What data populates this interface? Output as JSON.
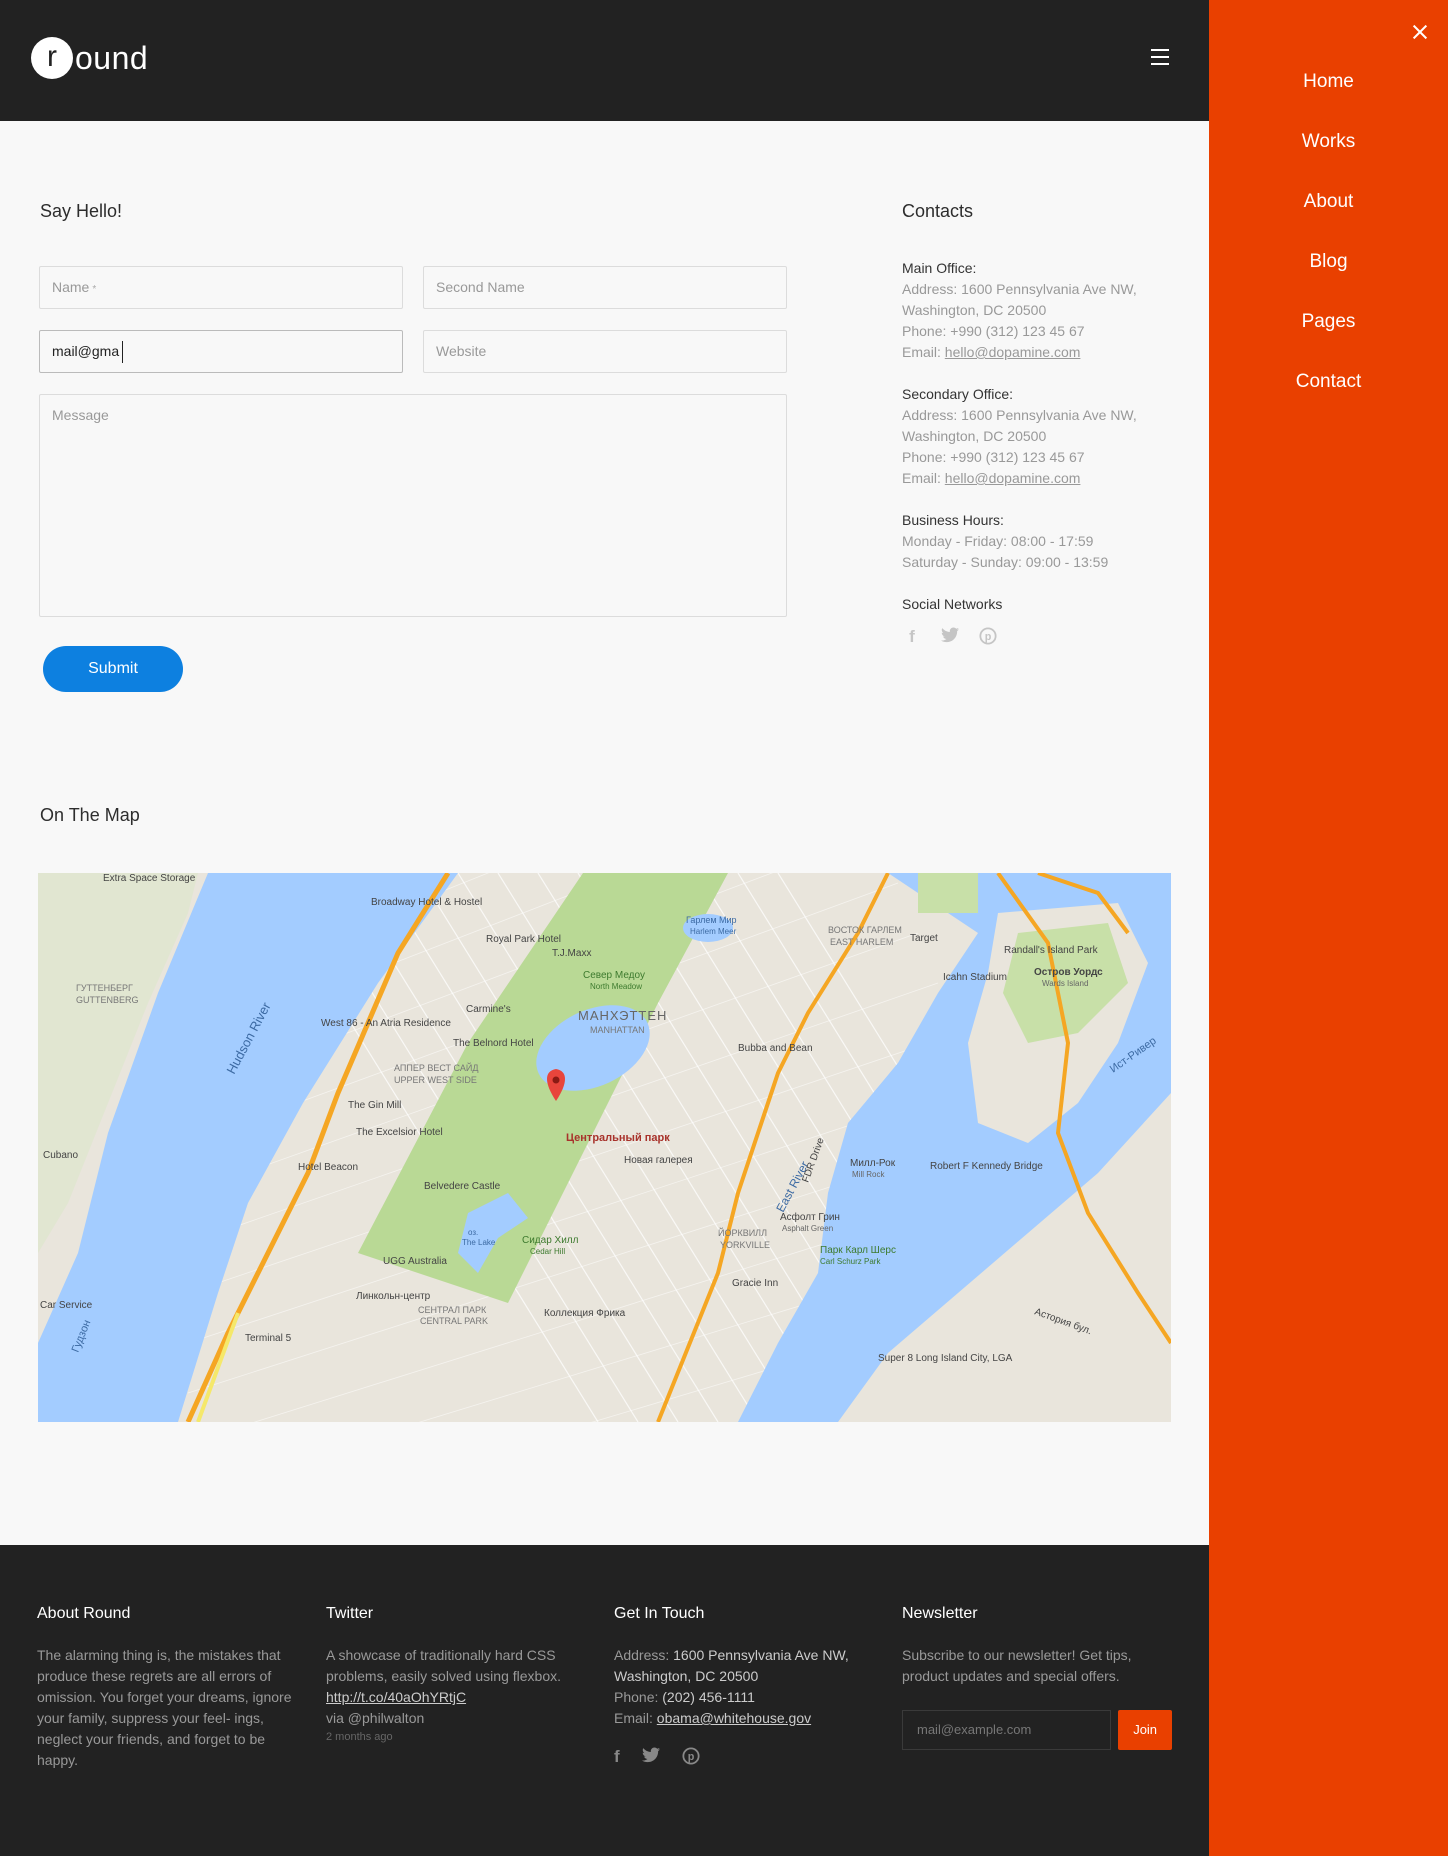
{
  "header": {
    "logo_letter": "r",
    "logo_text": "ound"
  },
  "side_menu": {
    "items": [
      "Home",
      "Works",
      "About",
      "Blog",
      "Pages",
      "Contact"
    ]
  },
  "form": {
    "title": "Say Hello!",
    "name_placeholder": "Name",
    "name_required_mark": "*",
    "second_name_placeholder": "Second Name",
    "email_value": "mail@gma",
    "website_placeholder": "Website",
    "message_placeholder": "Message",
    "submit_label": "Submit"
  },
  "contacts": {
    "title": "Contacts",
    "main_office": {
      "label": "Main Office:",
      "address_1": "Address: 1600 Pennsylvania Ave NW,",
      "address_2": "Washington, DC 20500",
      "phone": "Phone: +990 (312) 123 45 67",
      "email_label": "Email: ",
      "email": "hello@dopamine.com"
    },
    "secondary_office": {
      "label": "Secondary Office:",
      "address_1": "Address: 1600 Pennsylvania Ave NW,",
      "address_2": "Washington, DC 20500",
      "phone": "Phone: +990 (312) 123 45 67",
      "email_label": "Email: ",
      "email": "hello@dopamine.com"
    },
    "hours": {
      "label": "Business Hours:",
      "weekdays": "Monday - Friday: 08:00 - 17:59",
      "weekend": "Saturday - Sunday: 09:00 - 13:59"
    },
    "social_label": "Social Networks"
  },
  "map_section": {
    "title": "On The Map",
    "labels": {
      "hudson": "Hudson River",
      "east_river": "East River",
      "central_park": "Центральный парк",
      "manhattan": "МАНХЭТТЕН",
      "manhattan_en": "MANHATTAN",
      "upper_west": "АППЕР ВЕСТ САЙД",
      "upper_west_en": "UPPER WEST SIDE",
      "yorkville": "ЙОРКВИЛЛ",
      "yorkville_en": "YORKVILLE",
      "east_harlem": "ВОСТОК ГАРЛЕМ",
      "east_harlem_en": "EAST HARLEM",
      "guttenberg": "ГУТТЕНБЕРГ",
      "guttenberg_en": "GUTTENBERG",
      "randalls": "Randall's Island Park",
      "wards": "Остров Уордс",
      "wards_en": "Wards Island",
      "rfk": "Robert F Kennedy Bridge",
      "mill_rock": "Милл-Рок",
      "mill_rock_en": "Mill Rock",
      "carl_schurz": "Парк Карл Шерс",
      "carl_schurz_en": "Carl Schurz Park",
      "belvedere": "Belvedere Castle",
      "gallery": "Новая галерея",
      "frick": "Коллекция Фрика",
      "fdr": "FDR Drive",
      "broadway_hotel": "Broadway Hotel & Hostel",
      "royal_park": "Royal Park Hotel",
      "tjmaxx": "T.J.Maxx",
      "belnord": "The Belnord Hotel",
      "excelsior": "The Excelsior Hotel",
      "hotel_beacon": "Hotel Beacon",
      "gin_mill": "The Gin Mill",
      "extra_space": "Extra Space Storage",
      "icahn": "Icahn Stadium",
      "target": "Target",
      "bubba": "Bubba and Bean",
      "gracie": "Gracie Inn",
      "ugg": "UGG Australia",
      "lincoln": "Линкольн-центр",
      "terminal": "Terminal 5",
      "super8": "Super 8 Long Island City, LGA",
      "astoria": "Астория бул.",
      "cubano": "Cubano",
      "car_service": "Car Service",
      "carmines": "Carmine's",
      "west86": "West 86 - An Atria Residence",
      "harlem_meer": "Гарлем Мир",
      "harlem_meer_en": "Harlem Meer",
      "north_meadow": "Север Медоу",
      "north_meadow_en": "North Meadow",
      "cedar_hill": "Сидар Хилл",
      "cedar_hill_en": "Cedar Hill",
      "asphalt_green": "Асфолт Грин",
      "asphalt_green_en": "Asphalt Green",
      "central_park_s": "СЕНТРАЛ ПАРК",
      "central_park_s_en": "CENTRAL PARK",
      "the_lake": "оз.",
      "the_lake_en": "The Lake",
      "east_river_label": "Ист-Ривер",
      "gudzon": "Гудзон"
    }
  },
  "footer": {
    "about": {
      "title": "About Round",
      "text": "The alarming thing is, the mistakes that produce these regrets are all errors of omission. You forget your dreams, ignore your family, suppress your feel- ings, neglect your friends, and forget to be happy."
    },
    "twitter": {
      "title": "Twitter",
      "text": "A showcase of traditionally hard CSS problems, easily solved using flexbox.",
      "link": "http://t.co/40aOhYRtjC",
      "via": "via @philwalton",
      "time": "2 months ago"
    },
    "touch": {
      "title": "Get In Touch",
      "address_label": "Address: ",
      "address_1": "1600 Pennsylvania Ave NW,",
      "address_2": "Washington, DC 20500",
      "phone_label": "Phone: ",
      "phone": "(202) 456-1111",
      "email_label": "Email: ",
      "email": "obama@whitehouse.gov"
    },
    "newsletter": {
      "title": "Newsletter",
      "text": "Subscribe to our newsletter! Get tips, product updates and special offers.",
      "placeholder": "mail@example.com",
      "button": "Join"
    }
  },
  "colors": {
    "accent": "#e94000",
    "primary_button": "#0d80e0",
    "dark": "#222222"
  }
}
